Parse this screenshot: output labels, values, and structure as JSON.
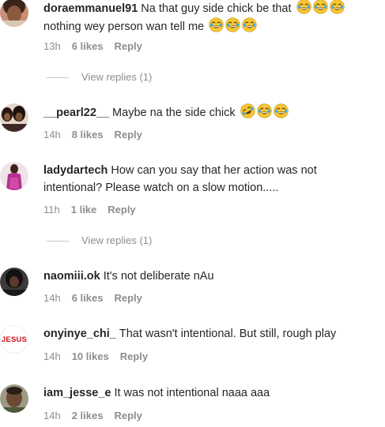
{
  "comments": [
    {
      "username": "doraemmanuel91",
      "text": "Na that guy side chick be that",
      "text2": "nothing wey person wan tell me",
      "time": "13h",
      "likes": "6 likes",
      "reply": "Reply",
      "view_replies": "View replies (1)"
    },
    {
      "username": "__pearl22__",
      "text": "Maybe na the side chick",
      "time": "14h",
      "likes": "8 likes",
      "reply": "Reply"
    },
    {
      "username": "ladydartech",
      "text": "How can you say that her action was not intentional? Please watch on a slow motion.....",
      "time": "11h",
      "likes": "1 like",
      "reply": "Reply",
      "view_replies": "View replies (1)"
    },
    {
      "username": "naomiii.ok",
      "text": "It's not deliberate nAu",
      "time": "14h",
      "likes": "6 likes",
      "reply": "Reply"
    },
    {
      "username": "onyinye_chi_",
      "text": "That wasn't intentional. But still, rough play",
      "time": "14h",
      "likes": "10 likes",
      "reply": "Reply",
      "avatar_text": "JESUS"
    },
    {
      "username": "iam_jesse_e",
      "text": "It was not intentional naaa aaa",
      "time": "14h",
      "likes": "2 likes",
      "reply": "Reply"
    }
  ],
  "icons": {
    "laughing": "face-with-tears-of-joy-icon",
    "rofl": "rolling-on-floor-laughing-icon"
  },
  "colors": {
    "meta_gray": "#8e8e8e",
    "text": "#262626",
    "jesus_red": "#d0121b"
  }
}
